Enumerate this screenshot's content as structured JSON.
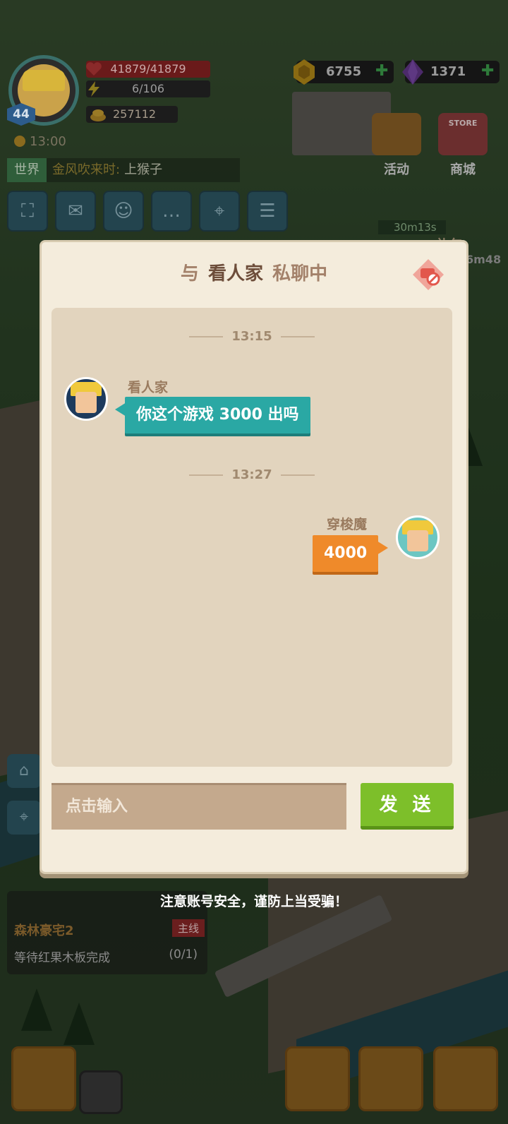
{
  "hud": {
    "level": "44",
    "hp": "41879/41879",
    "energy": "6/106",
    "gold": "257112",
    "clock": "13:00",
    "coins": "6755",
    "gems": "1371",
    "world_channel": {
      "tag": "世界",
      "sender": "金风吹来时:",
      "message": "上猴子"
    },
    "activity_label": "活动",
    "store_sign": "STORE",
    "store_label": "商城",
    "timer": "30m13s",
    "gift_label": "礼包",
    "gift_timer": "6m48"
  },
  "quest": {
    "title": "森林豪宅2",
    "tag": "主线",
    "description": "等待红果木板完成",
    "progress": "(0/1)"
  },
  "dialog": {
    "title_prefix": "与",
    "partner_name": "看人家",
    "title_suffix": "私聊中",
    "input_placeholder": "点击输入",
    "send_label": "发 送"
  },
  "messages": [
    {
      "time": "13:15",
      "sender": "看人家",
      "text": "你这个游戏 3000 出吗",
      "side": "left"
    },
    {
      "time": "13:27",
      "sender": "穿梭魔",
      "text": "4000",
      "side": "right"
    }
  ],
  "warning": "注意账号安全，谨防上当受骗！",
  "colors": {
    "teal_bubble": "#2aa8a4",
    "orange_bubble": "#ef8a2a",
    "send_green": "#7dbf2a",
    "dialog_bg": "#f4ecdc"
  }
}
